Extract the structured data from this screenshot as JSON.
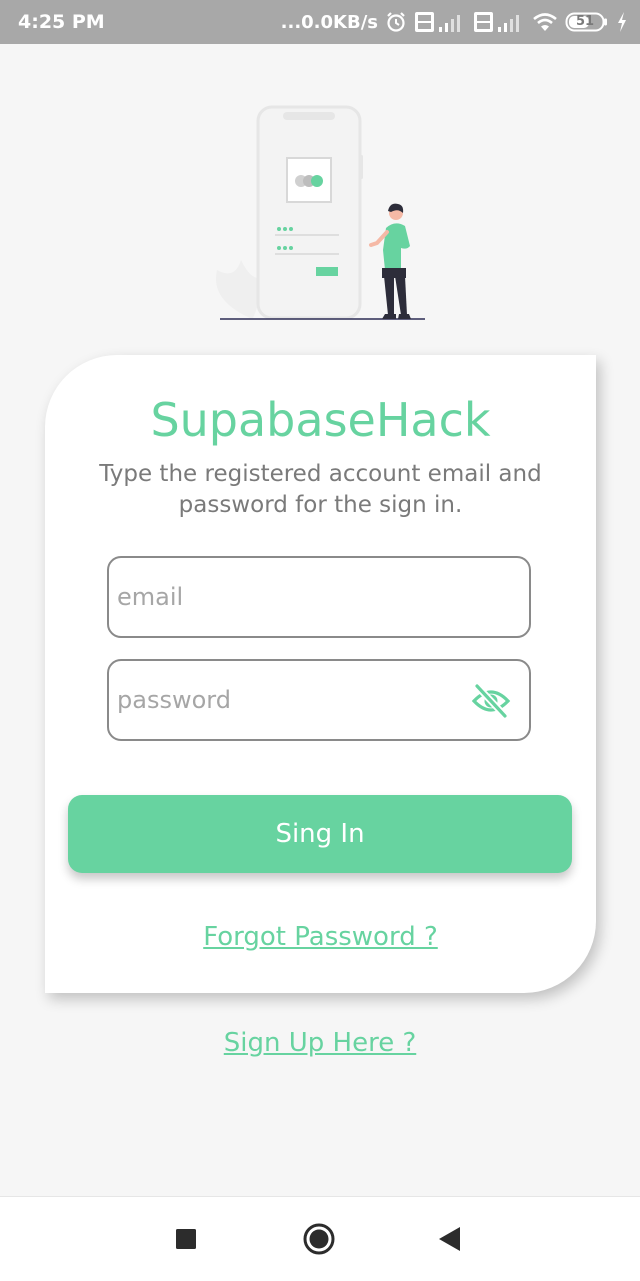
{
  "status_bar": {
    "time": "4:25 PM",
    "network_speed": "...0.0KB/s",
    "icons": [
      "alarm-icon",
      "volte-signal-icon",
      "volte-signal-icon",
      "wifi-icon",
      "battery-icon",
      "charging-icon"
    ],
    "battery_level": "51"
  },
  "login": {
    "app_title": "SupabaseHack",
    "subtitle": "Type the registered account email and password for the sign in.",
    "email_placeholder": "email",
    "password_placeholder": "password",
    "password_visibility_icon": "eye-off-icon",
    "signin_label": "Sing In",
    "forgot_password_label": "Forgot Password ?"
  },
  "signup_label": "Sign Up Here ?",
  "nav_bar": {
    "icons": [
      "recent-apps-icon",
      "home-icon",
      "back-icon"
    ]
  },
  "colors": {
    "accent": "#67d3a0",
    "background": "#f6f6f6",
    "status_bar": "#a8a8a8",
    "subtitle_text": "#7a7a7a"
  }
}
